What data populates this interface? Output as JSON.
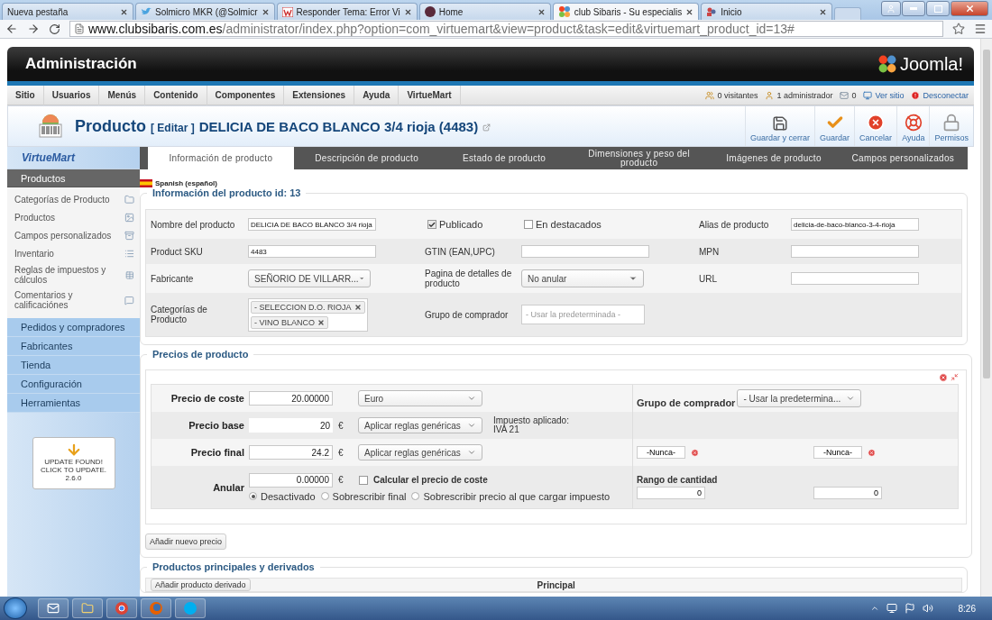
{
  "browser_tabs": [
    {
      "label": "Nueva pestaña",
      "selected": false
    },
    {
      "label": "Solmicro MKR (@Solmicr",
      "selected": false
    },
    {
      "label": "Responder Tema: Error Vi",
      "selected": false
    },
    {
      "label": "Home",
      "selected": false
    },
    {
      "label": "club Sibaris - Su especialis",
      "selected": true
    },
    {
      "label": "Inicio",
      "selected": false
    }
  ],
  "address": {
    "domain": "www.clubsibaris.com.es",
    "path": "/administrator/index.php?option=com_virtuemart&view=product&task=edit&virtuemart_product_id=13#"
  },
  "header": {
    "title": "Administración",
    "logo": "Joomla!"
  },
  "menu": [
    "Sitio",
    "Usuarios",
    "Menús",
    "Contenido",
    "Componentes",
    "Extensiones",
    "Ayuda",
    "VirtueMart"
  ],
  "status": [
    {
      "kind": "visitors",
      "label": "0 visitantes"
    },
    {
      "kind": "admins",
      "label": "1 administrador"
    },
    {
      "kind": "messages",
      "label": "0"
    },
    {
      "kind": "site",
      "label": "Ver sitio"
    },
    {
      "kind": "logout",
      "label": "Desconectar"
    }
  ],
  "page_title": {
    "title": "Producto",
    "edit": "[ Editar ]",
    "product": "DELICIA DE BACO BLANCO 3/4 rioja (4483)"
  },
  "toolbar": [
    {
      "kind": "save_close",
      "label": "Guardar y cerrar"
    },
    {
      "kind": "save",
      "label": "Guardar"
    },
    {
      "kind": "cancel",
      "label": "Cancelar"
    },
    {
      "kind": "help",
      "label": "Ayuda"
    },
    {
      "kind": "permissions",
      "label": "Permisos"
    }
  ],
  "sidebar": {
    "logo": "VirtueMart",
    "sections": [
      {
        "label": "Productos",
        "expanded": true,
        "items": [
          "Categorías de Producto",
          "Productos",
          "Campos personalizados",
          "Inventario",
          "Reglas de impuestos y cálculos",
          "Comentarios y calificaciónes"
        ]
      },
      {
        "label": "Pedidos y compradores",
        "expanded": false
      },
      {
        "label": "Fabricantes",
        "expanded": false
      },
      {
        "label": "Tienda",
        "expanded": false
      },
      {
        "label": "Configuración",
        "expanded": false
      },
      {
        "label": "Herramientas",
        "expanded": false
      }
    ],
    "update": "UPDATE FOUND!\nCLICK TO UPDATE.\n2.6.0"
  },
  "tabs": [
    {
      "label": "Información de producto",
      "selected": true
    },
    {
      "label": "Descripción de producto",
      "selected": false
    },
    {
      "label": "Estado de producto",
      "selected": false
    },
    {
      "label": "Dimensiones y peso del producto",
      "selected": false
    },
    {
      "label": "Imágenes de producto",
      "selected": false
    },
    {
      "label": "Campos personalizados",
      "selected": false
    }
  ],
  "language": "Spanish (español)",
  "info": {
    "legend": "Información del producto id: 13",
    "rows": [
      {
        "cells": [
          {
            "kind": "label",
            "text": "Nombre del producto"
          },
          {
            "kind": "input",
            "value": "DELICIA DE BACO BLANCO 3/4 rioja"
          },
          {
            "kind": "check",
            "label": "Publicado",
            "checked": true
          },
          {
            "kind": "check",
            "label": "En destacados",
            "checked": false
          },
          {
            "kind": "label",
            "text": "Alias de producto"
          },
          {
            "kind": "input",
            "value": "delicia-de-baco-blanco-3-4-rioja"
          }
        ]
      },
      {
        "cells": [
          {
            "kind": "label",
            "text": "Product SKU"
          },
          {
            "kind": "input",
            "value": "4483"
          },
          {
            "kind": "label",
            "text": "GTIN (EAN,UPC)"
          },
          {
            "kind": "input"
          },
          {
            "kind": "label",
            "text": "MPN"
          },
          {
            "kind": "input"
          }
        ]
      },
      {
        "cells": [
          {
            "kind": "label",
            "text": "Fabricante"
          },
          {
            "kind": "select",
            "value": "SEÑORIO DE VILLARR..."
          },
          {
            "kind": "label",
            "text": "Pagina de detalles de producto"
          },
          {
            "kind": "select",
            "value": "No anular"
          },
          {
            "kind": "label",
            "text": "URL"
          },
          {
            "kind": "input"
          }
        ]
      },
      {
        "cells": [
          {
            "kind": "label",
            "text": "Categorías de Producto"
          },
          {
            "kind": "tags",
            "tags": [
              "- SELECCION D.O. RIOJA",
              "- VINO BLANCO"
            ]
          },
          {
            "kind": "label",
            "text": "Grupo de comprador"
          },
          {
            "kind": "placeholder",
            "placeholder": "- Usar la predeterminada -"
          }
        ]
      }
    ]
  },
  "prices": {
    "legend": "Precios de producto",
    "rows": [
      {
        "label": "Precio de coste",
        "amount": {
          "kind": "input",
          "value": "20.00000"
        },
        "select": "Euro",
        "right": {
          "kind": "group",
          "label": "Grupo de comprador",
          "select": "- Usar la predetermina..."
        }
      },
      {
        "label": "Precio base",
        "amount": {
          "kind": "text",
          "value": "20"
        },
        "currency": "€",
        "select": "Aplicar reglas genéricas",
        "note": "Impuesto aplicado:\nIVA 21"
      },
      {
        "label": "Precio final",
        "amount": {
          "kind": "input",
          "value": "24.2"
        },
        "currency": "€",
        "select": "Aplicar reglas genéricas",
        "right": {
          "kind": "dates",
          "values": [
            "-Nunca-",
            "-Nunca-"
          ]
        }
      },
      {
        "label": "Anular",
        "amount": {
          "kind": "input",
          "value": "0.00000"
        },
        "currency": "€",
        "check": {
          "label": "Calcular el precio de coste",
          "checked": false
        },
        "radios": [
          {
            "label": "Desactivado",
            "selected": true
          },
          {
            "label": "Sobrescribir final",
            "selected": false
          },
          {
            "label": "Sobrescribir precio al que cargar impuesto",
            "selected": false
          }
        ],
        "right": {
          "kind": "range",
          "label": "Rango de cantidad",
          "values": [
            "0",
            "0"
          ]
        }
      }
    ],
    "add_button": "Añadir nuevo precio"
  },
  "derived": {
    "legend": "Productos principales y derivados",
    "button": "Añadir producto derivado",
    "column": "Principal"
  },
  "taskbar": {
    "time": "8:26"
  }
}
